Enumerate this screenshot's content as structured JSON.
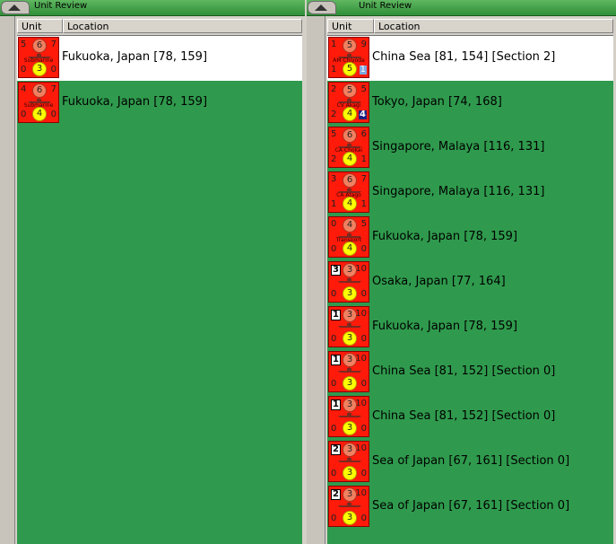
{
  "left_panel": {
    "title": "Unit Review",
    "columns": {
      "unit": "Unit",
      "location": "Location"
    },
    "rows": [
      {
        "name": "Submarine",
        "tl": "5",
        "top": "6",
        "tr": "7",
        "bl": "0",
        "bottom": "3",
        "br": "0",
        "location": "Fukuoka, Japan [78, 159]",
        "selected": true
      },
      {
        "name": "Submarine",
        "tl": "4",
        "top": "6",
        "tr": "7",
        "bl": "0",
        "bottom": "4",
        "br": "0",
        "location": "Fukuoka, Japan [78, 159]",
        "selected": false
      }
    ]
  },
  "right_panel": {
    "title": "Unit Review",
    "columns": {
      "unit": "Unit",
      "location": "Location"
    },
    "rows": [
      {
        "name": "AM Chiyoda",
        "tl": "1",
        "top": "5",
        "tr": "9",
        "bl": "1",
        "bottom": "5",
        "br": "1",
        "br_style": "boxblue",
        "location": "China Sea [81, 154] [Section 2]",
        "selected": true
      },
      {
        "name": "CV Akagi",
        "tl": "2",
        "top": "5",
        "tr": "5",
        "bl": "2",
        "bottom": "4",
        "br": "4",
        "br_style": "boxnavy",
        "location": "Tokyo, Japan [74, 168]",
        "selected": false
      },
      {
        "name": "CA Chokai",
        "tl": "5",
        "top": "6",
        "tr": "6",
        "bl": "2",
        "bottom": "4",
        "br": "1",
        "location": "Singapore, Malaya [116, 131]",
        "selected": false
      },
      {
        "name": "CA Atago",
        "tl": "3",
        "top": "6",
        "tr": "7",
        "bl": "1",
        "bottom": "4",
        "br": "1",
        "location": "Singapore, Malaya [116, 131]",
        "selected": false
      },
      {
        "name": "Transport",
        "tl": "0",
        "top": "4",
        "tr": "5",
        "bl": "0",
        "bottom": "4",
        "br": "0",
        "location": "Fukuoka, Japan [78, 159]",
        "selected": false
      },
      {
        "name": "",
        "tl": "3",
        "tl_style": "boxed",
        "top": "3",
        "tr": "10",
        "bl": "0",
        "bottom": "3",
        "br": "0",
        "location": "Osaka, Japan [77, 164]",
        "selected": false
      },
      {
        "name": "",
        "tl": "1",
        "tl_style": "boxed",
        "top": "3",
        "tr": "10",
        "bl": "0",
        "bottom": "3",
        "br": "0",
        "location": "Fukuoka, Japan [78, 159]",
        "selected": false
      },
      {
        "name": "",
        "tl": "1",
        "tl_style": "boxed",
        "top": "3",
        "tr": "10",
        "bl": "0",
        "bottom": "3",
        "br": "0",
        "location": "China Sea [81, 152] [Section 0]",
        "selected": false
      },
      {
        "name": "",
        "tl": "1",
        "tl_style": "boxed",
        "top": "3",
        "tr": "10",
        "bl": "0",
        "bottom": "3",
        "br": "0",
        "location": "China Sea [81, 152] [Section 0]",
        "selected": false
      },
      {
        "name": "",
        "tl": "2",
        "tl_style": "boxed",
        "top": "3",
        "tr": "10",
        "bl": "0",
        "bottom": "3",
        "br": "0",
        "location": "Sea of Japan [67, 161] [Section 0]",
        "selected": false
      },
      {
        "name": "",
        "tl": "2",
        "tl_style": "boxed",
        "top": "3",
        "tr": "10",
        "bl": "0",
        "bottom": "3",
        "br": "0",
        "location": "Sea of Japan [67, 161] [Section 0]",
        "selected": false
      }
    ]
  },
  "colors": {
    "list_bg": "#2f9a4d",
    "counter_red": "#ff1a0a",
    "title_green": "#3fa048",
    "selected_row": "#ffffff"
  }
}
